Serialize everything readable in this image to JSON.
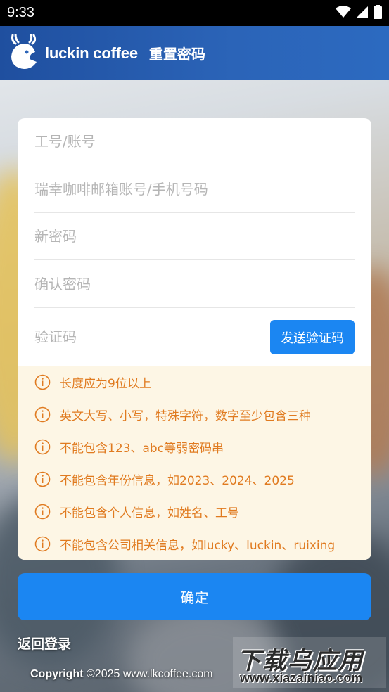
{
  "status_bar": {
    "time": "9:33"
  },
  "header": {
    "brand": "luckin coffee",
    "title": "重置密码"
  },
  "form": {
    "account_placeholder": "工号/账号",
    "email_phone_placeholder": "瑞幸咖啡邮箱账号/手机号码",
    "new_password_placeholder": "新密码",
    "confirm_password_placeholder": "确认密码",
    "code_placeholder": "验证码",
    "send_code_label": "发送验证码"
  },
  "tips": [
    "长度应为9位以上",
    "英文大写、小写，特殊字符，数字至少包含三种",
    "不能包含123、abc等弱密码串",
    "不能包含年份信息，如2023、2024、2025",
    "不能包含个人信息，如姓名、工号",
    "不能包含公司相关信息，如lucky、luckin、ruixing"
  ],
  "confirm_label": "确定",
  "back_login_label": "返回登录",
  "copyright": {
    "prefix": "Copyright",
    "text": "©2025 www.lkcoffee.com"
  },
  "watermark": {
    "main": "下载乌应用",
    "sub": "www.xiazainiao.com"
  },
  "colors": {
    "primary": "#1b86f2",
    "header": "#2b64b8",
    "tip_text": "#e07a1f",
    "tip_bg": "#fdf6e5"
  }
}
